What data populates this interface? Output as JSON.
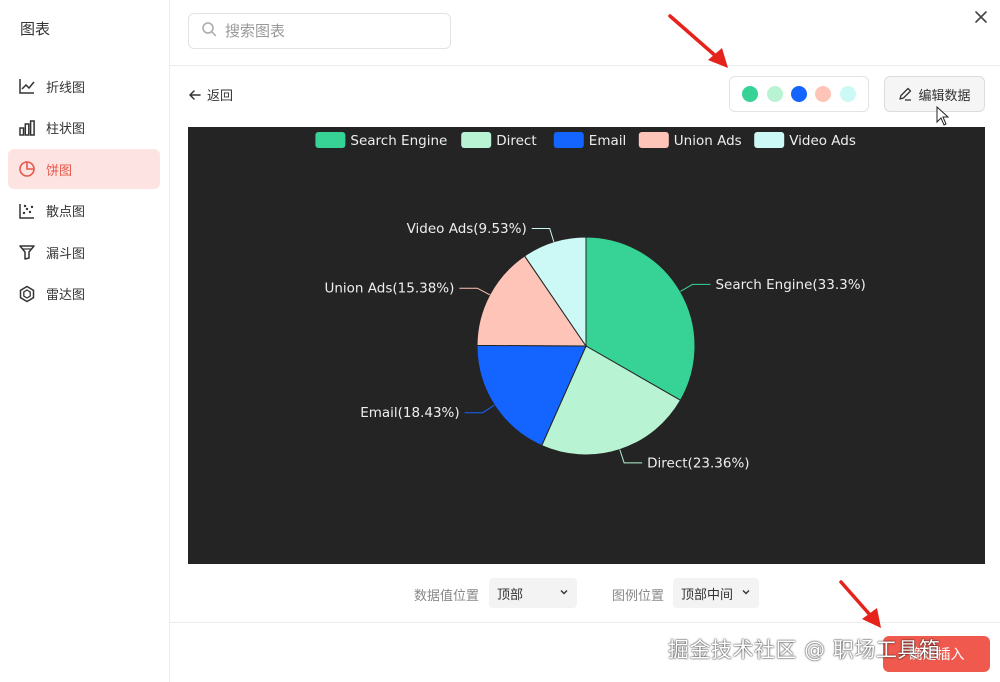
{
  "sidebar": {
    "title": "图表",
    "items": [
      {
        "label": "折线图",
        "icon": "line-chart-icon"
      },
      {
        "label": "柱状图",
        "icon": "bar-chart-icon"
      },
      {
        "label": "饼图",
        "icon": "pie-chart-icon",
        "active": true
      },
      {
        "label": "散点图",
        "icon": "scatter-chart-icon"
      },
      {
        "label": "漏斗图",
        "icon": "funnel-chart-icon"
      },
      {
        "label": "雷达图",
        "icon": "radar-chart-icon"
      }
    ]
  },
  "search": {
    "placeholder": "搜索图表",
    "value": ""
  },
  "toolbar": {
    "back_label": "返回",
    "edit_label": "编辑数据",
    "palette": [
      "#37d396",
      "#b8f3d3",
      "#1464ff",
      "#ffc4b8",
      "#ccf9f5"
    ]
  },
  "options": {
    "label_position_title": "数据值位置",
    "label_position_value": "顶部",
    "legend_position_title": "图例位置",
    "legend_position_value": "顶部中间"
  },
  "footer": {
    "confirm_label": "确定插入",
    "watermark": "掘金技术社区 @ 职场工具箱"
  },
  "chart_data": {
    "type": "pie",
    "legend_position": "top-center",
    "series": [
      {
        "name": "Search Engine",
        "percent": 33.3,
        "label": "Search Engine(33.3%)",
        "color": "#37d396"
      },
      {
        "name": "Direct",
        "percent": 23.36,
        "label": "Direct(23.36%)",
        "color": "#b8f3d3"
      },
      {
        "name": "Email",
        "percent": 18.43,
        "label": "Email(18.43%)",
        "color": "#1464ff"
      },
      {
        "name": "Union Ads",
        "percent": 15.38,
        "label": "Union Ads(15.38%)",
        "color": "#ffc4b8"
      },
      {
        "name": "Video Ads",
        "percent": 9.53,
        "label": "Video Ads(9.53%)",
        "color": "#ccf9f5"
      }
    ]
  }
}
